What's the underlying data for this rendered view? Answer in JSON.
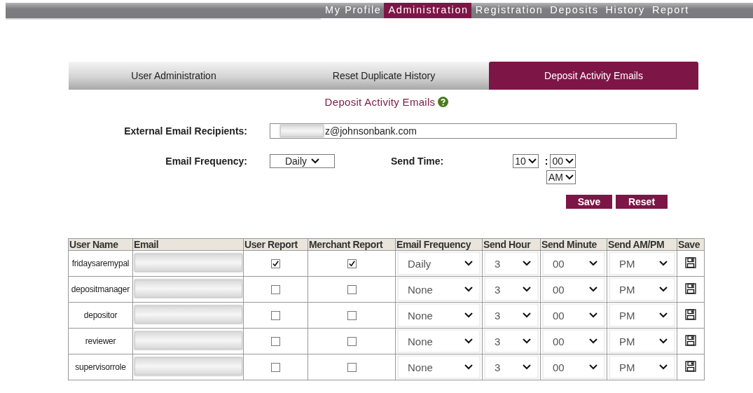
{
  "nav": [
    {
      "label": "My Profile",
      "selected": false
    },
    {
      "label": "Administration",
      "selected": true
    },
    {
      "label": "Registration",
      "selected": false
    },
    {
      "label": "Deposits",
      "selected": false
    },
    {
      "label": "History",
      "selected": false
    },
    {
      "label": "Report",
      "selected": false
    }
  ],
  "tabs": [
    {
      "label": "User Administration",
      "selected": false
    },
    {
      "label": "Reset Duplicate History",
      "selected": false
    },
    {
      "label": "Deposit Activity Emails",
      "selected": true
    }
  ],
  "heading": "Deposit Activity Emails",
  "form": {
    "recipients_label": "External Email Recipients:",
    "recipients_value": "z@johnsonbank.com",
    "frequency_label": "Email Frequency:",
    "frequency": "Daily",
    "send_time_label": "Send Time:",
    "hour": "10",
    "separator": ":",
    "minute": "00",
    "ampm": "AM"
  },
  "buttons": [
    "Save",
    "Reset"
  ],
  "table": {
    "columns": [
      "User Name",
      "Email",
      "User Report",
      "Merchant Report",
      "Email Frequency",
      "Send Hour",
      "Send Minute",
      "Send AM/PM",
      "Save"
    ],
    "rows": [
      {
        "user_name": "fridaysaremypal",
        "user_report": true,
        "merchant_report": true,
        "frequency": "Daily",
        "hour": "3",
        "minute": "00",
        "ampm": "PM"
      },
      {
        "user_name": "depositmanager",
        "user_report": false,
        "merchant_report": false,
        "frequency": "None",
        "hour": "3",
        "minute": "00",
        "ampm": "PM"
      },
      {
        "user_name": "depositor",
        "user_report": false,
        "merchant_report": false,
        "frequency": "None",
        "hour": "3",
        "minute": "00",
        "ampm": "PM"
      },
      {
        "user_name": "reviewer",
        "user_report": false,
        "merchant_report": false,
        "frequency": "None",
        "hour": "3",
        "minute": "00",
        "ampm": "PM"
      },
      {
        "user_name": "supervisorrole",
        "user_report": false,
        "merchant_report": false,
        "frequency": "None",
        "hour": "3",
        "minute": "00",
        "ampm": "PM"
      }
    ]
  }
}
